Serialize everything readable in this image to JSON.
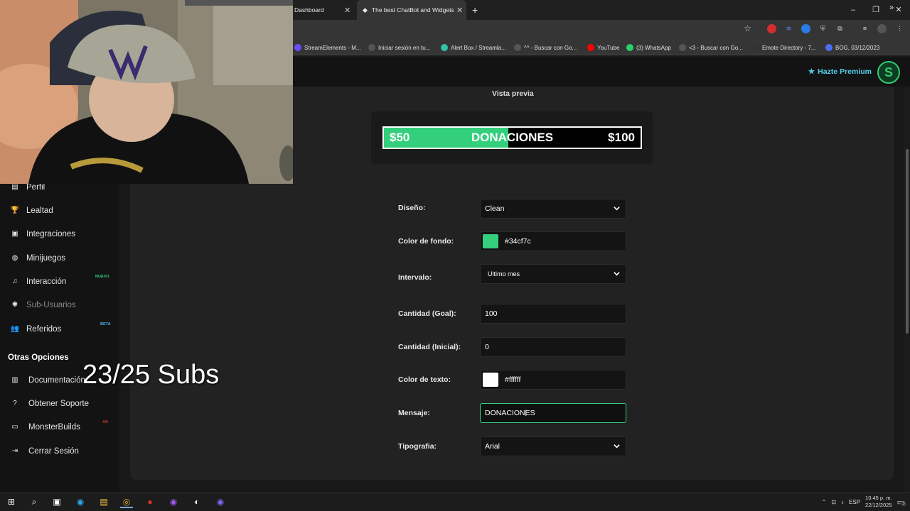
{
  "browser": {
    "tabs": [
      {
        "title": "Dashboard"
      },
      {
        "title": "The best ChatBot and Widgets"
      }
    ],
    "new_tab": "+",
    "window_controls": {
      "minimize": "–",
      "restore": "❐",
      "close": "✕"
    },
    "bookmarks": [
      {
        "label": "StreamElements - M...",
        "icon": "streamelements-icon",
        "color": "#6c4cff"
      },
      {
        "label": "Iniciar sesión en tu...",
        "icon": "globe-icon",
        "color": "#555555"
      },
      {
        "label": "Alert Box / Streamla...",
        "icon": "streamlabs-icon",
        "color": "#31c3a2"
      },
      {
        "label": "^^ - Buscar con Go...",
        "icon": "google-icon",
        "color": "#555555"
      },
      {
        "label": "YouTube",
        "icon": "youtube-icon",
        "color": "#ff0000"
      },
      {
        "label": "(3) WhatsApp",
        "icon": "whatsapp-icon",
        "color": "#25d366"
      },
      {
        "label": "<3 - Buscar con Go...",
        "icon": "google-icon",
        "color": "#555555"
      },
      {
        "label": "Emote Directory - 7...",
        "icon": "7tv-icon",
        "color": "#333333"
      },
      {
        "label": "BOG, 03/12/2023",
        "icon": "document-icon",
        "color": "#4a6cf7"
      }
    ],
    "bookmarks_overflow": "»"
  },
  "header": {
    "premium_label": "Hazte Premium",
    "logo_letter": "S"
  },
  "sidebar": {
    "items": [
      {
        "label": "Perfil",
        "icon": "profile-card-icon",
        "badge": ""
      },
      {
        "label": "Lealtad",
        "icon": "trophy-icon",
        "badge": ""
      },
      {
        "label": "Integraciones",
        "icon": "integrations-icon",
        "badge": ""
      },
      {
        "label": "Minijuegos",
        "icon": "gamepad-icon",
        "badge": ""
      },
      {
        "label": "Interacción",
        "icon": "music-note-icon",
        "badge": "NUEVO"
      },
      {
        "label": "Sub-Usuarios",
        "icon": "sub-users-icon",
        "badge": ""
      },
      {
        "label": "Referidos",
        "icon": "users-icon",
        "badge": "BETA"
      }
    ],
    "section_title": "Otras Opciones",
    "other_items": [
      {
        "label": "Documentación",
        "icon": "book-icon",
        "badge": ""
      },
      {
        "label": "Obtener Soporte",
        "icon": "help-icon",
        "badge": ""
      },
      {
        "label": "MonsterBuilds",
        "icon": "laptop-icon",
        "badge": "AD"
      },
      {
        "label": "Cerrar Sesión",
        "icon": "logout-icon",
        "badge": ""
      }
    ],
    "badge_colors": {
      "NUEVO": "#34cf7c",
      "BETA": "#4fb0e8",
      "AD": "#c0392b"
    }
  },
  "preview": {
    "title": "Vista previa",
    "left_value": "$50",
    "message": "DONACIONES",
    "right_value": "$100",
    "progress": 0.5,
    "fill_color": "#34cf7c",
    "text_color": "#ffffff"
  },
  "form": {
    "design_label": "Diseño:",
    "design_value": "Clean",
    "bg_color_label": "Color de fondo:",
    "bg_color_value": "#34cf7c",
    "interval_label": "Intervalo:",
    "interval_value": "Ultimo mes",
    "goal_label": "Cantidad (Goal):",
    "goal_value": "100",
    "initial_label": "Cantidad (Inicial):",
    "initial_value": "0",
    "text_color_label": "Color de texto:",
    "text_color_value": "#ffffff",
    "message_label": "Mensaje:",
    "message_value": "DONACIONES",
    "font_label": "Tipografia:",
    "font_value": "Arial"
  },
  "overlay": {
    "subs_counter": "23/25 Subs"
  },
  "taskbar": {
    "language": "ESP",
    "time": "10:45 p. m.",
    "date": "22/12/2025",
    "notifications": "3"
  }
}
